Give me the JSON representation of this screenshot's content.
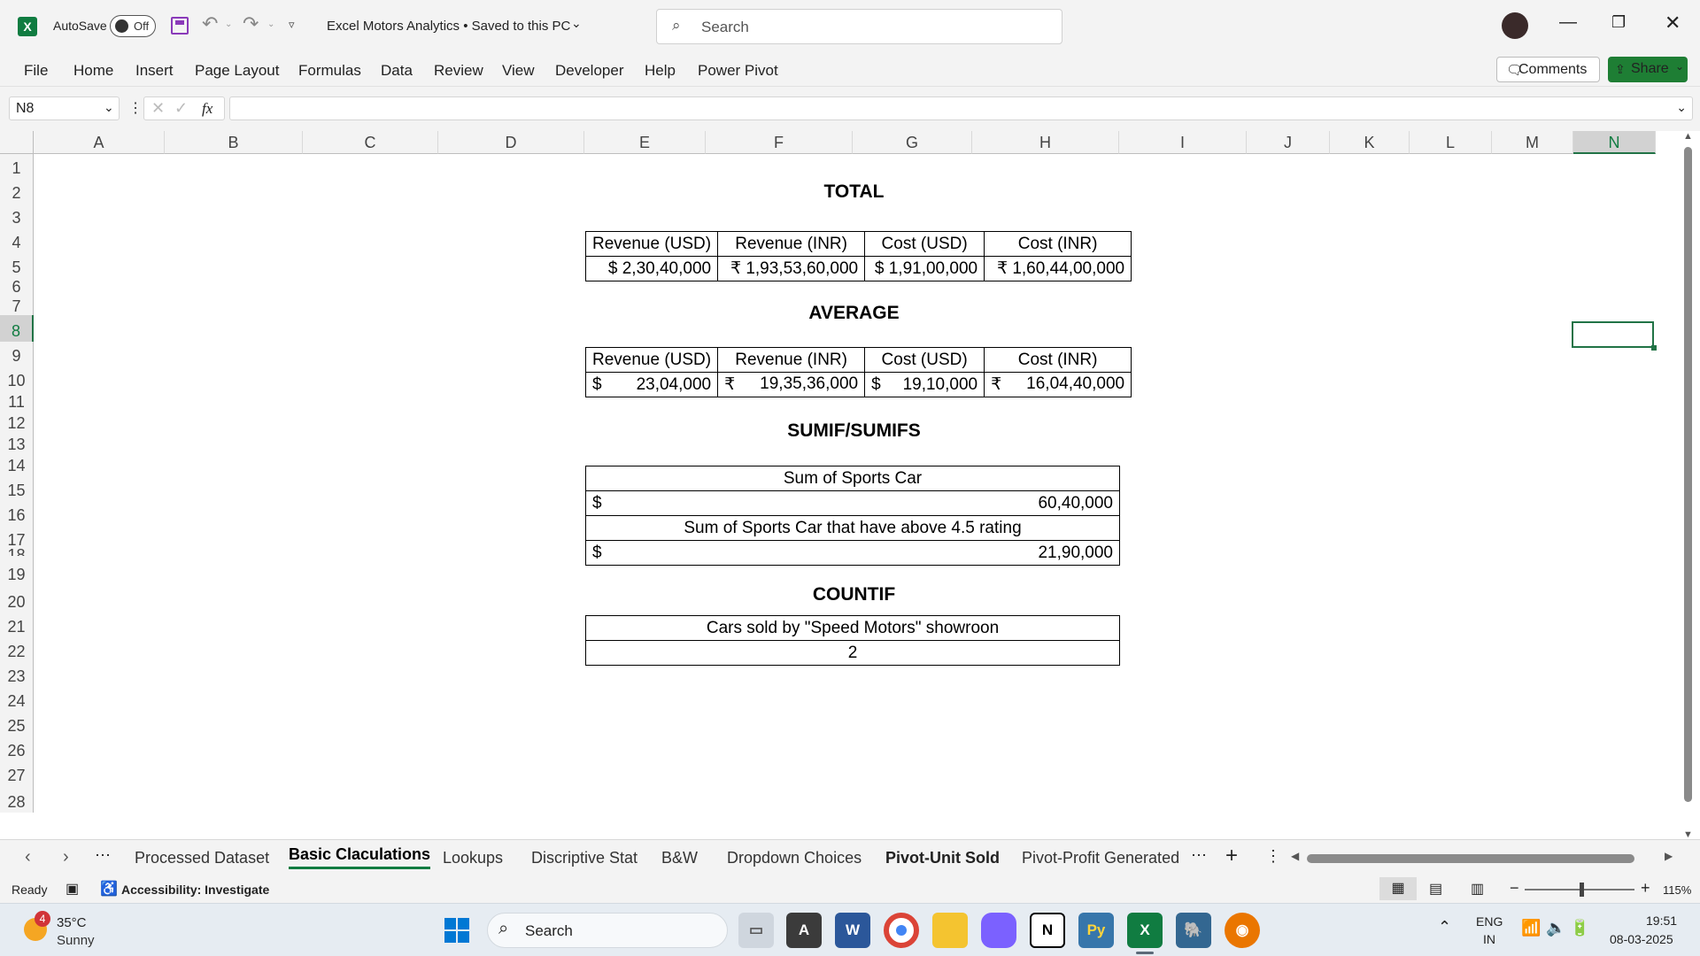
{
  "title_bar": {
    "app_icon": "excel-icon",
    "autosave_label": "AutoSave",
    "autosave_state": "Off",
    "doc_title": "Excel Motors Analytics • Saved to this PC",
    "search_placeholder": "Search"
  },
  "menu": [
    "File",
    "Home",
    "Insert",
    "Page Layout",
    "Formulas",
    "Data",
    "Review",
    "View",
    "Developer",
    "Help",
    "Power Pivot"
  ],
  "comments_label": "Comments",
  "share_label": "Share",
  "formula_bar": {
    "name_box": "N8",
    "fx_label": "fx",
    "formula": ""
  },
  "columns": [
    "A",
    "B",
    "C",
    "D",
    "E",
    "F",
    "G",
    "H",
    "I",
    "J",
    "K",
    "L",
    "M",
    "N"
  ],
  "rows": [
    "1",
    "2",
    "3",
    "4",
    "5",
    "6",
    "7",
    "8",
    "9",
    "10",
    "11",
    "12",
    "13",
    "14",
    "15",
    "16",
    "17",
    "18",
    "19",
    "20",
    "21",
    "22",
    "23",
    "24",
    "25",
    "26",
    "27",
    "28"
  ],
  "sheet": {
    "total_title": "TOTAL",
    "headers": [
      "Revenue (USD)",
      "Revenue (INR)",
      "Cost (USD)",
      "Cost (INR)"
    ],
    "total_values": [
      "$ 2,30,40,000",
      "₹ 1,93,53,60,000",
      "$ 1,91,00,000",
      "₹ 1,60,44,00,000"
    ],
    "average_title": "AVERAGE",
    "average_values": [
      {
        "sym": "$",
        "num": "23,04,000"
      },
      {
        "sym": "₹",
        "num": "19,35,36,000"
      },
      {
        "sym": "$",
        "num": "19,10,000"
      },
      {
        "sym": "₹",
        "num": "16,04,40,000"
      }
    ],
    "sumif_title": "SUMIF/SUMIFS",
    "sum_sports_label": "Sum of Sports Car",
    "sum_sports_sym": "$",
    "sum_sports_value": "60,40,000",
    "sum_sports_rating_label": "Sum of Sports Car that have above 4.5 rating",
    "sum_sports_rating_sym": "$",
    "sum_sports_rating_value": "21,90,000",
    "countif_title": "COUNTIF",
    "countif_label": "Cars sold by \"Speed Motors\" showroon",
    "countif_value": "2"
  },
  "sheet_tabs": [
    "Processed Dataset",
    "Basic Claculations",
    "Lookups",
    "Discriptive Stat",
    "B&W",
    "Dropdown Choices",
    "Pivot-Unit Sold",
    "Pivot-Profit Generated"
  ],
  "active_tab": "Basic Claculations",
  "status": {
    "ready": "Ready",
    "accessibility": "Accessibility: Investigate",
    "zoom": "115%"
  },
  "taskbar": {
    "weather_temp": "35°C",
    "weather_desc": "Sunny",
    "weather_badge": "4",
    "search_label": "Search",
    "lang_top": "ENG",
    "lang_bottom": "IN",
    "time": "19:51",
    "date": "08-03-2025"
  },
  "colors": {
    "excel_green": "#107c41",
    "share_green": "#1e7e34",
    "selection": "#217346"
  }
}
